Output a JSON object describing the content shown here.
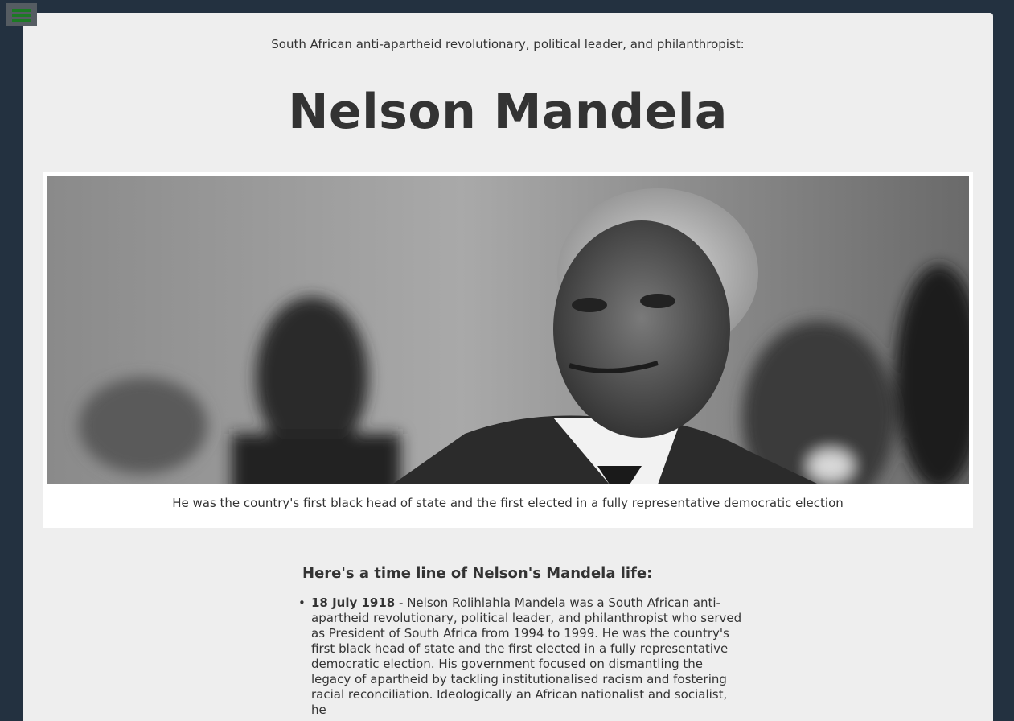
{
  "menu": {
    "icon": "hamburger-menu-icon",
    "accent": "#1c7a24"
  },
  "header": {
    "tagline": "South African anti-apartheid revolutionary, political leader, and philanthropist:",
    "title": "Nelson Mandela"
  },
  "figure": {
    "image_alt": "Black and white photo of Nelson Mandela",
    "caption": "He was the country's first black head of state and the first elected in a fully representative democratic election"
  },
  "timeline": {
    "heading": "Here's a time line of Nelson's Mandela life:",
    "items": [
      {
        "date": "18 July 1918",
        "text": " - Nelson Rolihlahla Mandela was a South African anti-apartheid revolutionary, political leader, and philanthropist who served as President of South Africa from 1994 to 1999. He was the country's first black head of state and the first elected in a fully representative democratic election. His government focused on dismantling the legacy of apartheid by tackling institutionalised racism and fostering racial reconciliation. Ideologically an African nationalist and socialist, he"
      }
    ]
  },
  "colors": {
    "background": "#233140",
    "card": "#eeeeee",
    "text": "#333333"
  }
}
